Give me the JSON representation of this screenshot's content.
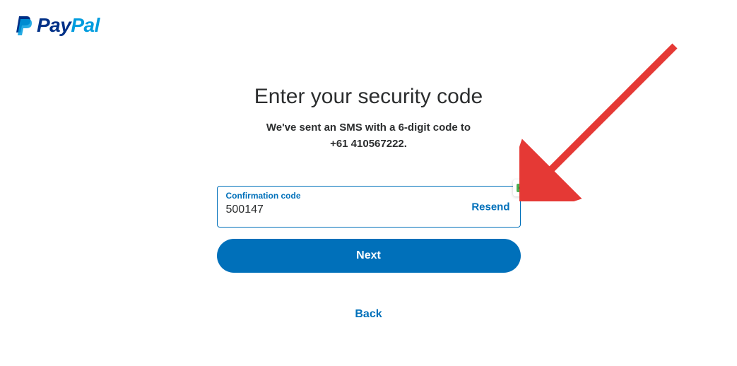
{
  "logo": {
    "text_part1": "Pay",
    "text_part2": "Pal"
  },
  "main": {
    "title": "Enter your security code",
    "subtitle_line1": "We've sent an SMS with a 6-digit code to",
    "subtitle_phone": "+61 410567222.",
    "input_label": "Confirmation code",
    "input_value": "500147",
    "resend_label": "Resend",
    "next_button_label": "Next",
    "back_link_label": "Back"
  },
  "colors": {
    "brand_primary": "#0070ba",
    "brand_dark": "#003087",
    "brand_light": "#009cde",
    "text": "#2c2e2f",
    "annotation": "#e53935"
  }
}
